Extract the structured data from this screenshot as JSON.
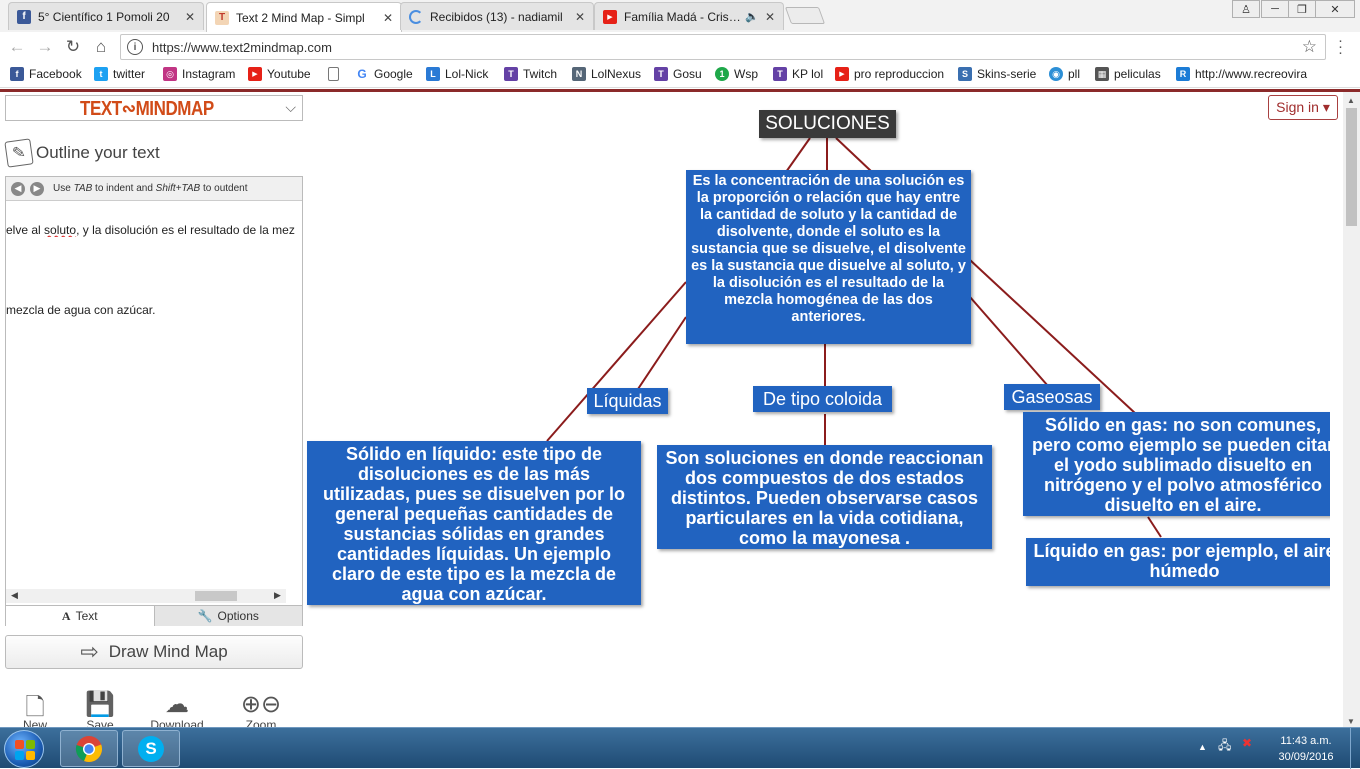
{
  "browser": {
    "tabs": [
      {
        "title": "5° Científico 1 Pomoli 20",
        "favicon": "facebook-icon",
        "color": "#3b5998",
        "active": false
      },
      {
        "title": "Text 2 Mind Map - Simpl",
        "favicon": "text2mindmap-icon",
        "color": "#e06b2b",
        "active": true
      },
      {
        "title": "Recibidos (13) - nadiamil",
        "favicon": "loading-icon",
        "color": "#4a8ee0",
        "active": false
      },
      {
        "title": "Família Madá - Cristal",
        "favicon": "youtube-icon",
        "color": "#e62117",
        "active": false
      }
    ],
    "close_glyph": "✕",
    "mute_glyph": "🔈",
    "url": "https://www.text2mindmap.com",
    "window_controls": {
      "profile": "profile-icon",
      "minimize": "─",
      "restore": "❐",
      "close": "✕"
    }
  },
  "bookmarks": [
    {
      "label": "Facebook",
      "icon": "facebook-icon",
      "color": "#3b5998",
      "glyph": "f"
    },
    {
      "label": "twitter",
      "icon": "twitter-icon",
      "color": "#1da1f2",
      "glyph": "t"
    },
    {
      "label": "Instagram",
      "icon": "instagram-icon",
      "color": "#c13584",
      "glyph": "◎"
    },
    {
      "label": "Youtube",
      "icon": "youtube-icon",
      "color": "#e62117",
      "glyph": "▶"
    },
    {
      "label": "",
      "icon": "page-icon",
      "color": "#ffffff",
      "glyph": ""
    },
    {
      "label": "Google",
      "icon": "google-icon",
      "color": "#4285f4",
      "glyph": "G"
    },
    {
      "label": "Lol-Nick",
      "icon": "lolnick-icon",
      "color": "#2a7ad5",
      "glyph": "L"
    },
    {
      "label": "Twitch",
      "icon": "twitch-icon",
      "color": "#6441a5",
      "glyph": "T"
    },
    {
      "label": "LolNexus",
      "icon": "lolnexus-icon",
      "color": "#556677",
      "glyph": "N"
    },
    {
      "label": "Gosu",
      "icon": "twitch-icon",
      "color": "#6441a5",
      "glyph": "T"
    },
    {
      "label": "Wsp",
      "icon": "whatsapp-icon",
      "color": "#1fa84a",
      "glyph": "1"
    },
    {
      "label": "KP lol",
      "icon": "twitch-icon",
      "color": "#6441a5",
      "glyph": "T"
    },
    {
      "label": "pro reproduccion",
      "icon": "youtube-icon",
      "color": "#e62117",
      "glyph": "▶"
    },
    {
      "label": "Skins-serie",
      "icon": "skins-icon",
      "color": "#3a6fb0",
      "glyph": "S"
    },
    {
      "label": "pll",
      "icon": "pll-icon",
      "color": "#2c8fd6",
      "glyph": "◉"
    },
    {
      "label": "peliculas",
      "icon": "film-icon",
      "color": "#555555",
      "glyph": "▦"
    },
    {
      "label": "http://www.recreovira",
      "icon": "recreo-icon",
      "color": "#1c7cd6",
      "glyph": "R"
    }
  ],
  "app": {
    "logo": "TEXT∾MINDMAP",
    "signin": "Sign in ▾",
    "outline_title": "Outline your text",
    "editor_hint_prefix": "Use ",
    "editor_hint_tab": "TAB",
    "editor_hint_mid": " to indent and ",
    "editor_hint_shift": "Shift+TAB",
    "editor_hint_suffix": " to outdent",
    "editor_lines": [
      {
        "before": "elve al ",
        "squiggle": "soluto",
        "after": ", y la disolución es el resultado de la mez"
      },
      {
        "before": "mezcla de agua con azúcar.",
        "squiggle": "",
        "after": ""
      }
    ],
    "editor_tabs": {
      "text": "Text",
      "options": "Options"
    },
    "draw_button": "Draw Mind Map",
    "tools": [
      {
        "label": "New",
        "icon": "new-document-icon"
      },
      {
        "label": "Save",
        "icon": "save-icon"
      },
      {
        "label": "Download",
        "icon": "download-cloud-icon"
      },
      {
        "label": "Zoom",
        "icon": "zoom-icon"
      }
    ]
  },
  "mindmap": {
    "node_color": "#2163c0",
    "root_color": "#3a3a3a",
    "link_color": "#8b1c1c",
    "root": "SOLUCIONES",
    "definition": "Es la concentración de una solución es la proporción o relación que hay entre la cantidad de soluto y la cantidad de disolvente, donde el soluto es la sustancia que se disuelve, el disolvente es la sustancia que disuelve al soluto, y la disolución es el resultado de la mezcla homogénea de las dos anteriores.",
    "liquidas": "Líquidas",
    "coloida": "De tipo coloida",
    "gaseosas": "Gaseosas",
    "solido_liquido": "Sólido en líquido: este tipo de disoluciones es de las más utilizadas, pues se disuelven por lo general pequeñas cantidades de sustancias sólidas en grandes cantidades líquidas. Un ejemplo claro de este tipo es la mezcla de agua con azúcar.",
    "coloida_desc": "Son soluciones en donde reaccionan dos compuestos de dos estados distintos. Pueden observarse casos particulares en la vida cotidiana, como la mayonesa .",
    "solido_gas": "Sólido en gas: no son comunes, pero como ejemplo se pueden citar el yodo sublimado disuelto en nitrógeno y el polvo atmosférico disuelto en el aire.",
    "liquido_gas": "Líquido en gas: por ejemplo, el aire húmedo"
  },
  "taskbar": {
    "apps": [
      {
        "name": "chrome",
        "icon": "chrome-icon"
      },
      {
        "name": "skype",
        "icon": "skype-icon"
      }
    ],
    "time": "11:43 a.m.",
    "date": "30/09/2016"
  }
}
